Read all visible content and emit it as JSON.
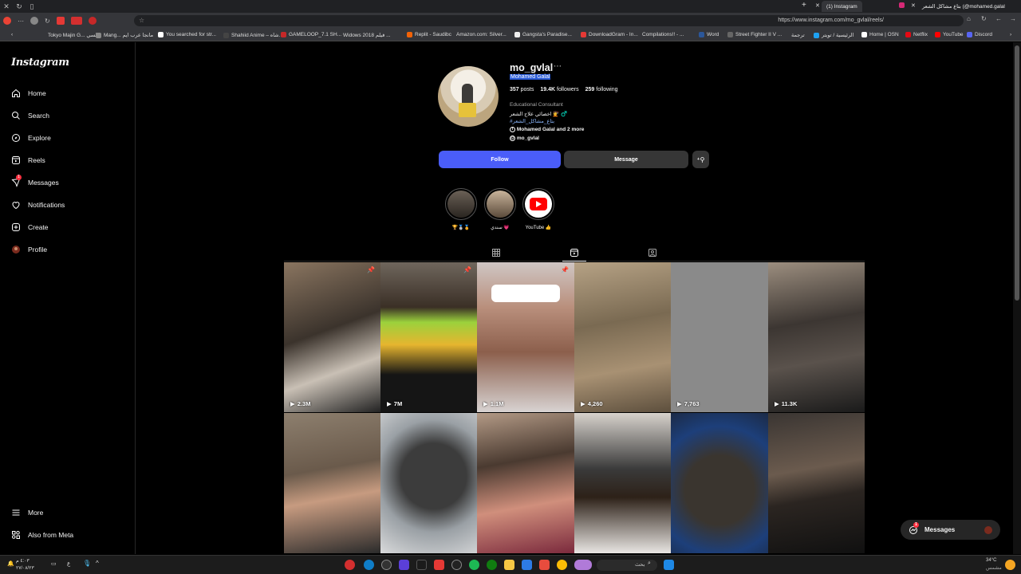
{
  "browser": {
    "tabs": [
      {
        "title": "(1) Instagram"
      },
      {
        "title": "بتاع مشاكل الشعر (@mohamed.galal"
      }
    ],
    "url": "https://www.instagram.com/mo_gvlal/reels/",
    "bookmarks": [
      "Tokyo Majin G... السي",
      "Mang... مانجا عرب ايم",
      "You searched for str...",
      "Shahiid Anime – شاه...",
      "GAMELOOP_7.1 SH...",
      "Widows 2018 فيلم ...",
      "Replit - Saudibc",
      "Amazon.com: Silver...",
      "Gangsta's Paradise...",
      "DownloadGram - In...",
      "Compilations!! - ...",
      "Word",
      "Street Fighter II V ...",
      "ترجمة",
      "الرئيسية / تويتر",
      "Home | OSN",
      "Netflix",
      "YouTube",
      "Discord"
    ]
  },
  "sidebar": {
    "logo": "Instagram",
    "items": [
      {
        "label": "Home",
        "icon": "home-icon"
      },
      {
        "label": "Search",
        "icon": "search-icon"
      },
      {
        "label": "Explore",
        "icon": "compass-icon"
      },
      {
        "label": "Reels",
        "icon": "reels-icon"
      },
      {
        "label": "Messages",
        "icon": "messenger-icon",
        "badge": "1"
      },
      {
        "label": "Notifications",
        "icon": "heart-icon"
      },
      {
        "label": "Create",
        "icon": "plus-square-icon"
      },
      {
        "label": "Profile",
        "icon": "profile-avatar-icon"
      }
    ],
    "bottom": [
      {
        "label": "More",
        "icon": "hamburger-icon"
      },
      {
        "label": "Also from Meta",
        "icon": "meta-icon"
      }
    ]
  },
  "profile": {
    "username": "mo_gvlal",
    "full_name": "Mohamed Galal",
    "posts": "357",
    "posts_label": "posts",
    "followers": "19.4K",
    "followers_label": "followers",
    "following": "259",
    "following_label": "following",
    "category": "Educational Consultant",
    "bio_line1": "اخصائي علاج الشعر 💇 ‍♂️",
    "bio_hashtag": "#بتاع_مشاكل_الشعر",
    "bio_facebook": "Mohamed Galal and 2 more",
    "bio_threads": "mo_gvlal",
    "follow_label": "Follow",
    "message_label": "Message"
  },
  "highlights": [
    {
      "label": "🏆🥈🏅"
    },
    {
      "label": "سندي 💗"
    },
    {
      "label": "YouTube 👍"
    }
  ],
  "reels": [
    {
      "views": "2.3M",
      "pinned": true
    },
    {
      "views": "7M",
      "pinned": true
    },
    {
      "views": "1.1M",
      "pinned": true
    },
    {
      "views": "4,260",
      "pinned": false
    },
    {
      "views": "7,763",
      "pinned": false
    },
    {
      "views": "11.3K",
      "pinned": false
    },
    {
      "views": "",
      "pinned": false
    },
    {
      "views": "",
      "pinned": false
    },
    {
      "views": "",
      "pinned": false
    },
    {
      "views": "",
      "pinned": false
    },
    {
      "views": "",
      "pinned": false
    },
    {
      "views": "",
      "pinned": false
    }
  ],
  "messages_pill": {
    "label": "Messages",
    "badge": "1"
  },
  "taskbar": {
    "search_placeholder": "بحث",
    "weather": "34°C",
    "weather_sub": "مشمس",
    "time": "٤:٠٣ م",
    "date": "٢٧/٠٨/٢٣",
    "lang": "ع"
  },
  "colors": {
    "follow_blue": "#4a5df9",
    "badge_red": "#ff3040",
    "button_gray": "#363636"
  }
}
